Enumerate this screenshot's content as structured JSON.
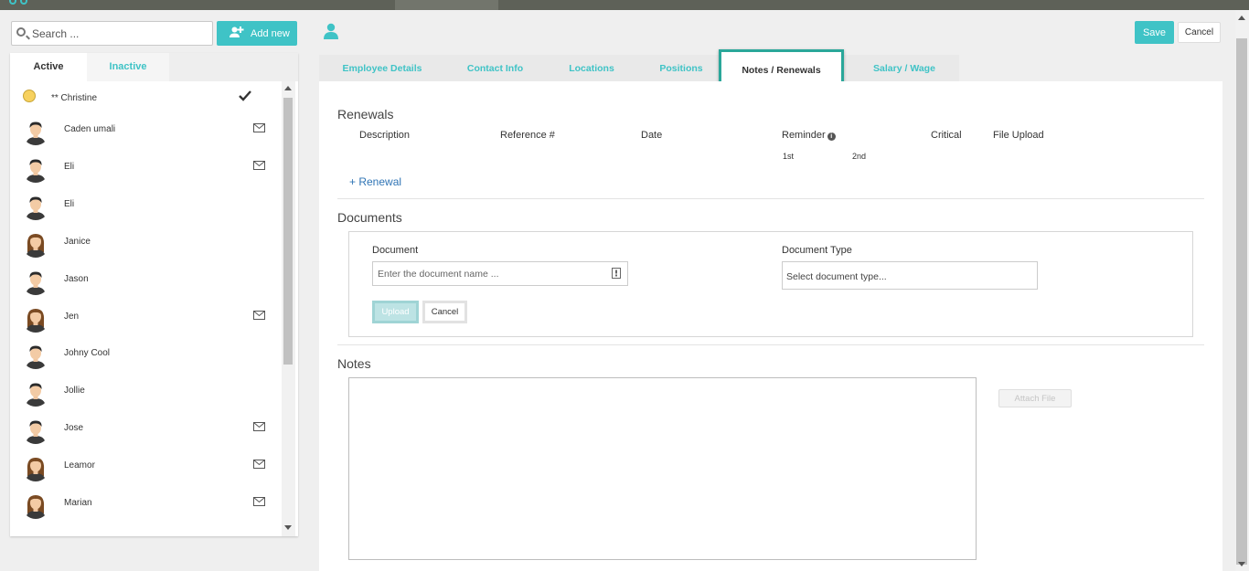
{
  "colors": {
    "accent": "#3fc3c6",
    "active_tab_border": "#2aa79a",
    "link": "#2f74b5"
  },
  "search": {
    "placeholder": "Search ..."
  },
  "toolbar": {
    "add_new_label": "Add new",
    "save_label": "Save",
    "cancel_label": "Cancel"
  },
  "left_tabs": [
    {
      "label": "Active",
      "selected": true
    },
    {
      "label": "Inactive",
      "selected": false
    }
  ],
  "employees": [
    {
      "name": "** Christine",
      "avatar": "smiley-icon",
      "indicator": "check-icon"
    },
    {
      "name": "Caden umali",
      "avatar": "male",
      "indicator": "mail-icon"
    },
    {
      "name": "Eli",
      "avatar": "male",
      "indicator": "mail-icon"
    },
    {
      "name": "Eli",
      "avatar": "male",
      "indicator": ""
    },
    {
      "name": "Janice",
      "avatar": "female",
      "indicator": ""
    },
    {
      "name": "Jason",
      "avatar": "male",
      "indicator": ""
    },
    {
      "name": "Jen",
      "avatar": "female",
      "indicator": "mail-icon"
    },
    {
      "name": "Johny Cool",
      "avatar": "male",
      "indicator": ""
    },
    {
      "name": "Jollie",
      "avatar": "male",
      "indicator": ""
    },
    {
      "name": "Jose",
      "avatar": "male",
      "indicator": "mail-icon"
    },
    {
      "name": "Leamor",
      "avatar": "female",
      "indicator": "mail-icon"
    },
    {
      "name": "Marian",
      "avatar": "female",
      "indicator": "mail-icon"
    }
  ],
  "tabs": [
    {
      "label": "Employee Details",
      "active": false
    },
    {
      "label": "Contact Info",
      "active": false
    },
    {
      "label": "Locations",
      "active": false
    },
    {
      "label": "Positions",
      "active": false
    },
    {
      "label": "Notes / Renewals",
      "active": true
    },
    {
      "label": "Salary / Wage",
      "active": false
    }
  ],
  "renewals": {
    "title": "Renewals",
    "columns": {
      "description": "Description",
      "reference": "Reference #",
      "date": "Date",
      "reminder": "Reminder",
      "critical": "Critical",
      "file_upload": "File Upload"
    },
    "reminder_sub": {
      "first": "1st",
      "second": "2nd"
    },
    "add_link": "+ Renewal"
  },
  "documents": {
    "title": "Documents",
    "document_label": "Document",
    "document_placeholder": "Enter the document name ...",
    "type_label": "Document Type",
    "type_placeholder": "Select document type...",
    "upload_label": "Upload",
    "cancel_label": "Cancel"
  },
  "notes": {
    "title": "Notes",
    "attach_label": "Attach File"
  }
}
